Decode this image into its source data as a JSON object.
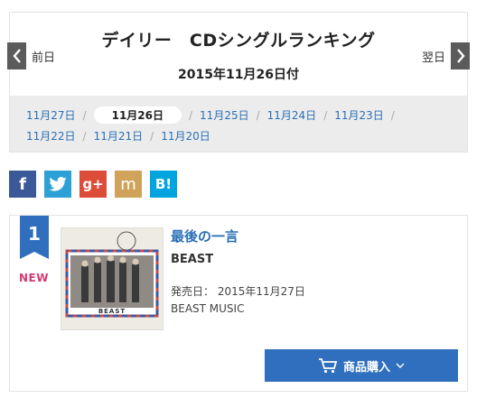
{
  "header": {
    "title": "デイリー　CDシングルランキング",
    "subtitle": "2015年11月26日付",
    "prev_label": "前日",
    "next_label": "翌日"
  },
  "dates": {
    "row1": [
      "11月27日",
      "11月26日",
      "11月25日",
      "11月24日",
      "11月23日"
    ],
    "row2": [
      "11月22日",
      "11月21日",
      "11月20日"
    ],
    "current_index": 1,
    "separator": "/"
  },
  "social": {
    "facebook": "f",
    "google_plus": "g+",
    "mixi": "m",
    "hatena": "B!"
  },
  "ranking": {
    "rank": "1",
    "badge": "NEW",
    "title": "最後の一言",
    "artist": "BEAST",
    "release_label": "発売日：",
    "release_date": "2015年11月27日",
    "label": "BEAST MUSIC",
    "jacket_text": "BEAST",
    "buy_label": "商品購入"
  },
  "colors": {
    "link_blue": "#2a6fb5",
    "rank_badge": "#2f6fbd",
    "new_pink": "#d63a73",
    "date_bar": "#ececec"
  }
}
